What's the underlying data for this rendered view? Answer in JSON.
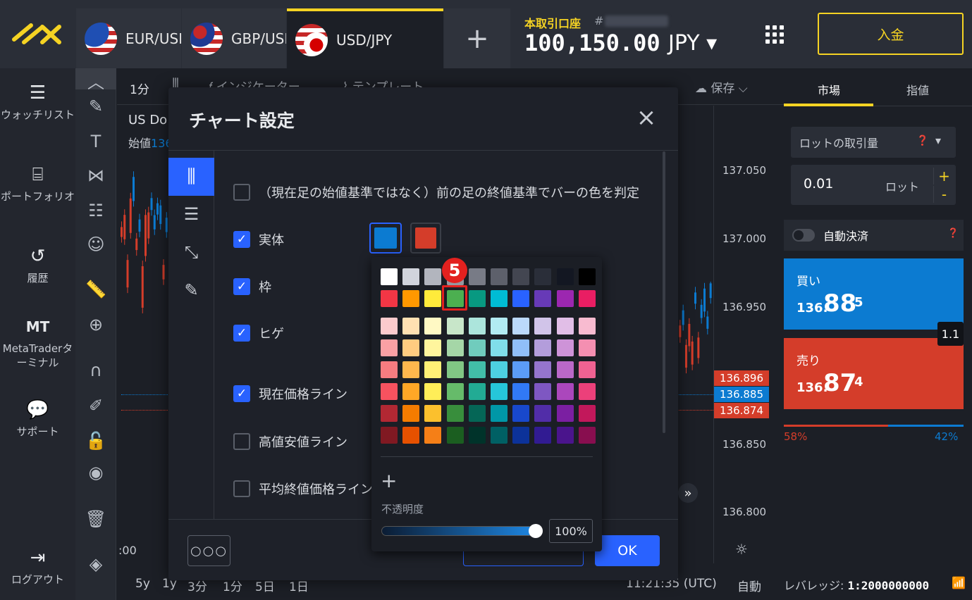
{
  "colors": {
    "accent": "#f5d323",
    "buy": "#0c7bd1",
    "sell": "#d43d2a",
    "primary": "#2962ff"
  },
  "tabs": [
    {
      "label": "EUR/USD"
    },
    {
      "label": "GBP/USD"
    },
    {
      "label": "USD/JPY"
    }
  ],
  "account": {
    "label": "本取引口座",
    "hash": "#",
    "balance": "100,150.00",
    "currency": "JPY ▾",
    "deposit": "入金"
  },
  "leftnav": [
    {
      "label": "ウォッチリスト",
      "icon": "list-icon"
    },
    {
      "label": "ポートフォリオ",
      "icon": "briefcase-icon"
    },
    {
      "label": "履歴",
      "icon": "history-icon"
    },
    {
      "label": "MetaTraderターミナル",
      "icon": "mt-icon",
      "glyph": "MT"
    },
    {
      "label": "サポート",
      "icon": "chat-icon"
    },
    {
      "label": "ログアウト",
      "icon": "logout-icon"
    }
  ],
  "chart": {
    "toolbar": {
      "interval": "1分",
      "indicators": "インジケーター",
      "templates": "テンプレート",
      "save": "保存"
    },
    "symbol": "US Do",
    "open_label": "始値",
    "open_value": "136",
    "price_levels": [
      "137.050",
      "137.000",
      "136.950",
      "136.850",
      "136.800"
    ],
    "tags": [
      {
        "v": "136.896",
        "c": "#d43d2a"
      },
      {
        "v": "136.885",
        "c": "#0c7bd1"
      },
      {
        "v": "136.874",
        "c": "#d43d2a"
      }
    ],
    "time_left": ":00",
    "bottom": {
      "ranges": [
        "5y",
        "1y",
        "3分",
        "1分",
        "5日",
        "1日"
      ],
      "clock": "11:21:35 (UTC)",
      "auto": "自動"
    }
  },
  "right": {
    "tab_market": "市場",
    "tab_limit": "指値",
    "order_label": "ロットの取引量",
    "lot_value": "0.01",
    "lot_unit": "ロット",
    "auto_close": "自動決済",
    "buy_label": "買い",
    "buy_small": "136.",
    "buy_big": "88",
    "buy_sup": "5",
    "sell_label": "売り",
    "sell_small": "136.",
    "sell_big": "87",
    "sell_sup": "4",
    "spread": "1.1",
    "sell_pct": "58%",
    "buy_pct": "42%",
    "leverage_label": "レバレッジ:",
    "leverage_value": "1:2000000000"
  },
  "dialog": {
    "title": "チャート設定",
    "options": [
      {
        "label": "（現在足の始値基準ではなく）前の足の終値基準でバーの色を判定",
        "checked": false
      },
      {
        "label": "実体",
        "checked": true
      },
      {
        "label": "枠",
        "checked": true
      },
      {
        "label": "ヒゲ",
        "checked": true
      },
      {
        "label": "現在価格ライン",
        "checked": true
      },
      {
        "label": "高値安値ライン",
        "checked": false
      },
      {
        "label": "平均終値価格ライン",
        "checked": false
      }
    ],
    "swatch_up": "#0c7bd1",
    "swatch_down": "#d43d2a",
    "badge": "5",
    "opacity_label": "不透明度",
    "opacity_value": "100%",
    "opacity_fraction": 1.0,
    "more": "○○○",
    "ok": "OK",
    "palette": [
      [
        "#ffffff",
        "#d1d4dc",
        "#b2b5be",
        "#9598a1",
        "#787b86",
        "#5d606b",
        "#434651",
        "#2a2e39",
        "#131722",
        "#000000"
      ],
      [
        "#f23645",
        "#ff9800",
        "#ffeb3b",
        "#4caf50",
        "#089981",
        "#00bcd4",
        "#2962ff",
        "#673ab7",
        "#9c27b0",
        "#e91e63"
      ],
      [
        "#fccbcd",
        "#ffe0b2",
        "#fff9c4",
        "#c8e6c9",
        "#ace5dc",
        "#b2ebf2",
        "#bbd9fb",
        "#d1c4e9",
        "#e1bee7",
        "#f8bbd0"
      ],
      [
        "#faa1a4",
        "#ffcc80",
        "#fff59d",
        "#a5d6a7",
        "#70ccbd",
        "#80deea",
        "#90bff9",
        "#b39ddb",
        "#ce93d8",
        "#f48fb1"
      ],
      [
        "#f77c80",
        "#ffb74d",
        "#fff176",
        "#81c784",
        "#42bda8",
        "#4dd0e1",
        "#5b9cf6",
        "#9575cd",
        "#ba68c8",
        "#f06292"
      ],
      [
        "#f7525f",
        "#ffa726",
        "#ffee58",
        "#66bb6a",
        "#22ab94",
        "#26c6da",
        "#3179f5",
        "#7e57c2",
        "#ab47bc",
        "#ec407a"
      ],
      [
        "#b22833",
        "#f57c00",
        "#fbc02d",
        "#388e3c",
        "#056656",
        "#0097a7",
        "#1848cc",
        "#512da8",
        "#7b1fa2",
        "#c2185b"
      ],
      [
        "#801922",
        "#e65100",
        "#f57f17",
        "#1b5e20",
        "#00332a",
        "#006064",
        "#0c3299",
        "#311b92",
        "#4a148c",
        "#880e4f"
      ]
    ]
  }
}
